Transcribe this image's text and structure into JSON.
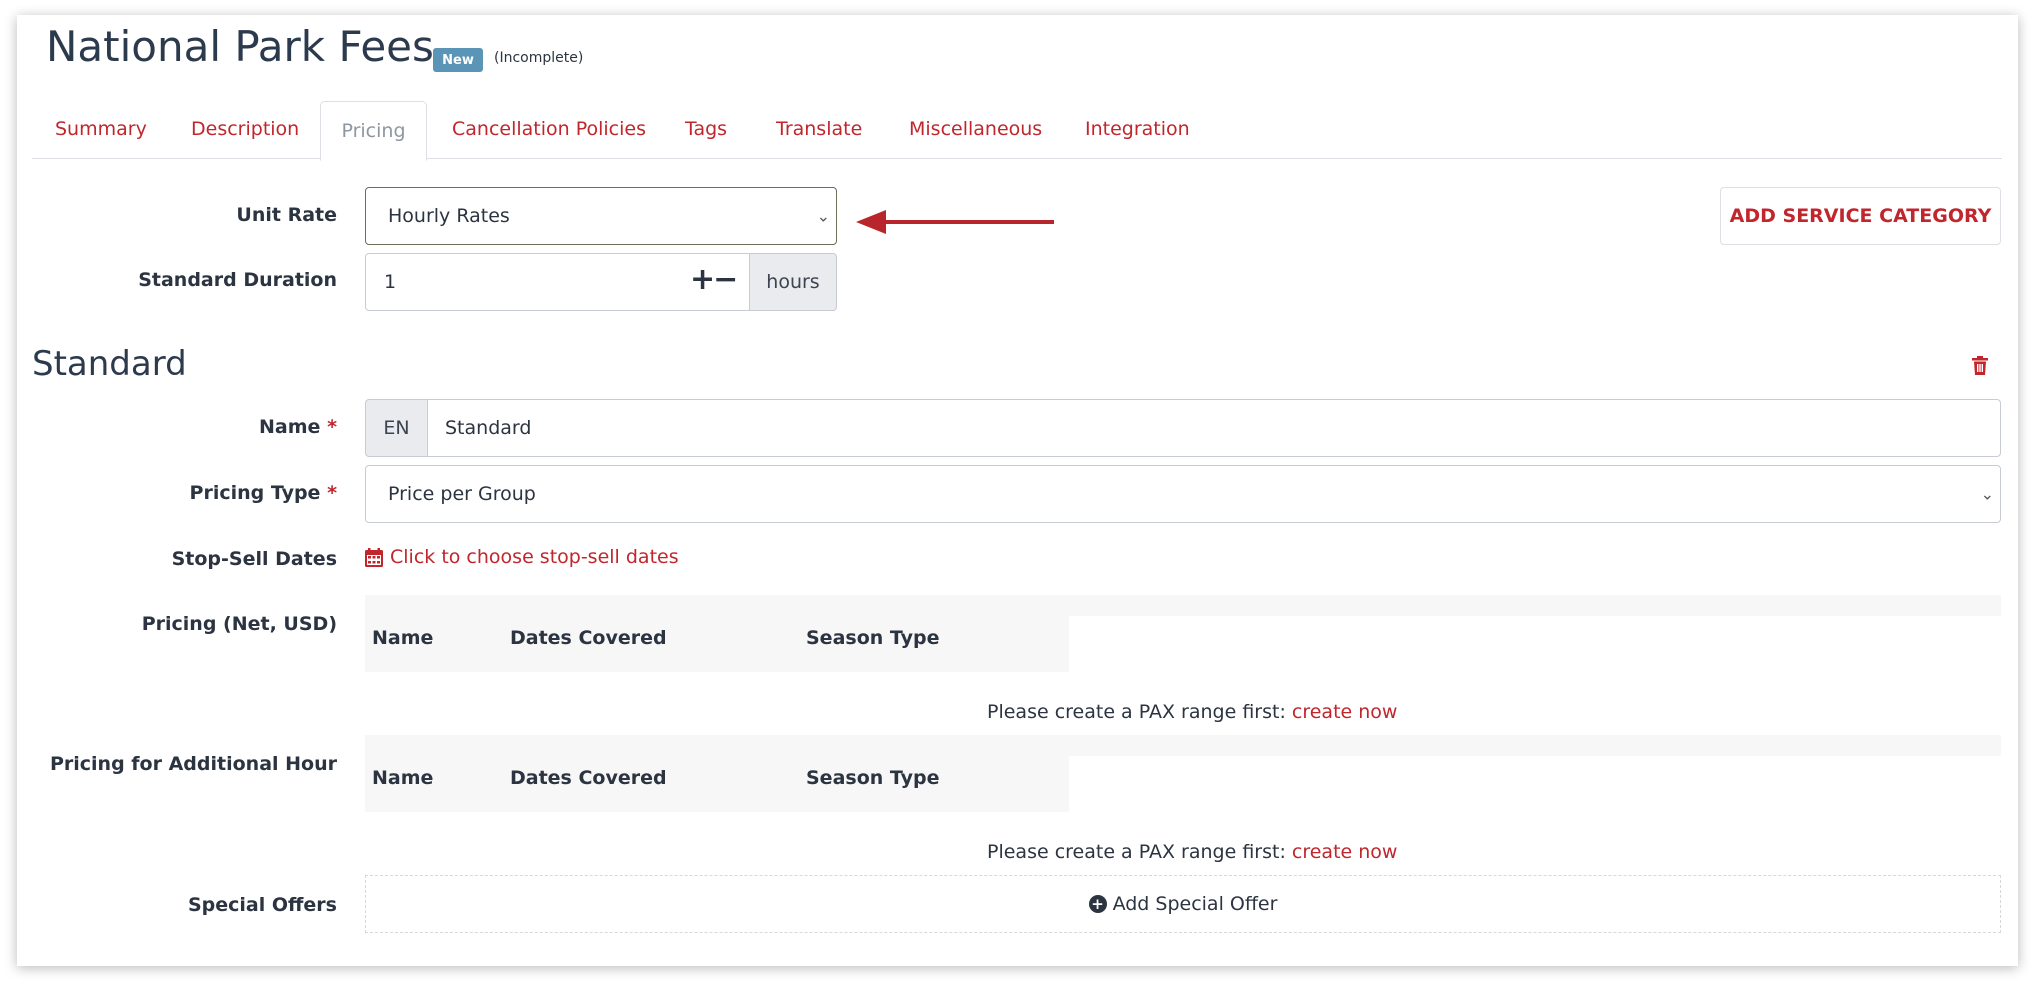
{
  "header": {
    "title": "National Park Fees",
    "badge": "New",
    "status": "(Incomplete)"
  },
  "tabs": [
    {
      "label": "Summary"
    },
    {
      "label": "Description"
    },
    {
      "label": "Pricing",
      "active": true
    },
    {
      "label": "Cancellation Policies"
    },
    {
      "label": "Tags"
    },
    {
      "label": "Translate"
    },
    {
      "label": "Miscellaneous"
    },
    {
      "label": "Integration"
    }
  ],
  "unit_rate": {
    "label": "Unit Rate",
    "value": "Hourly Rates"
  },
  "add_service_category": "ADD SERVICE CATEGORY",
  "standard_duration": {
    "label": "Standard Duration",
    "value": "1",
    "stepper": "+−",
    "unit": "hours"
  },
  "section": {
    "title": "Standard",
    "delete_icon": "trash-icon"
  },
  "name_field": {
    "label": "Name",
    "required": "*",
    "lang": "EN",
    "value": "Standard"
  },
  "pricing_type": {
    "label": "Pricing Type",
    "required": "*",
    "value": "Price per Group"
  },
  "stop_sell": {
    "label": "Stop-Sell Dates",
    "link": "Click to choose stop-sell dates",
    "icon": "calendar-icon"
  },
  "pricing_net": {
    "label": "Pricing (Net, USD)",
    "columns": [
      "Name",
      "Dates Covered",
      "Season Type"
    ],
    "message": "Please create a PAX range first:",
    "link": "create now"
  },
  "pricing_additional": {
    "label": "Pricing for Additional Hour",
    "columns": [
      "Name",
      "Dates Covered",
      "Season Type"
    ],
    "message": "Please create a PAX range first:",
    "link": "create now"
  },
  "special_offers": {
    "label": "Special Offers",
    "button": "Add Special Offer",
    "icon": "plus-circle-icon"
  },
  "colors": {
    "accent": "#c0262c",
    "badge": "#5a95b8",
    "text": "#2b3440",
    "arrow": "#b8262b"
  }
}
